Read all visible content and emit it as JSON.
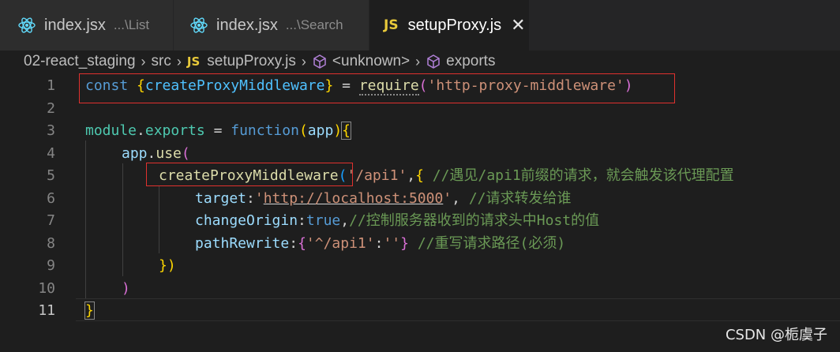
{
  "tabs": [
    {
      "icon": "react-icon",
      "name": "index.jsx",
      "desc": "...\\List"
    },
    {
      "icon": "react-icon",
      "name": "index.jsx",
      "desc": "...\\Search"
    },
    {
      "icon": "js-icon",
      "icon_label": "JS",
      "name": "setupProxy.js",
      "close": "✕",
      "active": true
    }
  ],
  "breadcrumb": {
    "folder": "02-react_staging",
    "src": "src",
    "js_label": "JS",
    "file": "setupProxy.js",
    "symbol1": "<unknown>",
    "symbol2": "exports",
    "separator": "›"
  },
  "line_numbers": [
    "1",
    "2",
    "3",
    "4",
    "5",
    "6",
    "7",
    "8",
    "9",
    "10",
    "11"
  ],
  "code": {
    "l1": {
      "const": "const",
      "open": "{",
      "name": "createProxyMiddleware",
      "close": "}",
      "eq": " = ",
      "req": "require",
      "p1": "(",
      "str": "'http-proxy-middleware'",
      "p2": ")"
    },
    "l3": {
      "module": "module",
      "dot": ".",
      "exports": "exports",
      "eq": " = ",
      "function": "function",
      "p1": "(",
      "arg": "app",
      "p2": ")",
      "brace": "{"
    },
    "l4": {
      "app": "app",
      "dot": ".",
      "use": "use",
      "p": "("
    },
    "l5": {
      "fn": "createProxyMiddleware",
      "p": "(",
      "str": "'/api1'",
      "comma": ",",
      "brace": "{",
      "comment": " //遇见/api1前缀的请求，就会触发该代理配置"
    },
    "l6": {
      "key": "target",
      "colon": ":",
      "str1": "'",
      "url": "http://localhost:5000",
      "str2": "'",
      "comma": ", ",
      "comment": "//请求转发给谁"
    },
    "l7": {
      "key": "changeOrigin",
      "colon": ":",
      "val": "true",
      "comma": ",",
      "comment": "//控制服务器收到的请求头中Host的值"
    },
    "l8": {
      "key": "pathRewrite",
      "colon": ":",
      "open": "{",
      "str1": "'^/api1'",
      "colon2": ":",
      "str2": "''",
      "close": "}",
      "comment": " //重写请求路径(必须)"
    },
    "l9": {
      "close": "})"
    },
    "l10": {
      "close": ")"
    },
    "l11": {
      "close": "}"
    }
  },
  "colors": {
    "highlight_box": "#e0312e",
    "js_icon": "#e8c93a",
    "react_icon": "#61dafb"
  },
  "watermark": "CSDN @栀虞子"
}
